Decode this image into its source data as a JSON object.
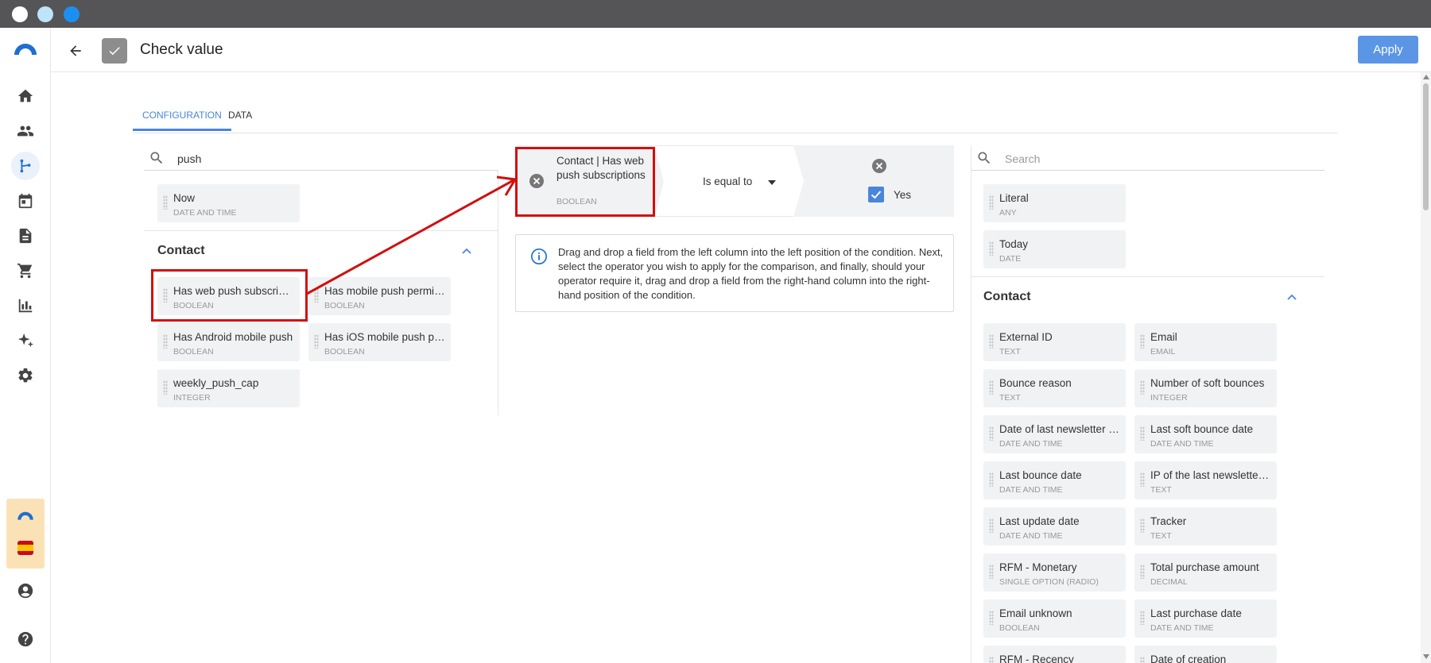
{
  "header": {
    "title": "Check value",
    "apply_label": "Apply"
  },
  "tabs": [
    {
      "label": "CONFIGURATION"
    },
    {
      "label": "DATA"
    }
  ],
  "left_panel": {
    "search_value": "push",
    "top_fields": [
      {
        "name": "Now",
        "type": "DATE AND TIME"
      }
    ],
    "section_title": "Contact",
    "contact_fields": [
      {
        "name": "Has web push subscriptions",
        "type": "BOOLEAN"
      },
      {
        "name": "Has mobile push permission",
        "type": "BOOLEAN"
      },
      {
        "name": "Has Android mobile push",
        "type": "BOOLEAN"
      },
      {
        "name": "Has iOS mobile push permission",
        "type": "BOOLEAN"
      },
      {
        "name": "weekly_push_cap",
        "type": "INTEGER"
      }
    ]
  },
  "condition": {
    "left_field_name": "Contact | Has web push subscriptions",
    "left_field_type": "BOOLEAN",
    "operator": "Is equal to",
    "right_value_label": "Yes",
    "right_checked": true
  },
  "info_text": "Drag and drop a field from the left column into the left position of the condition. Next, select the operator you wish to apply for the comparison, and finally, should your operator require it, drag and drop a field from the right-hand column into the right-hand position of the condition.",
  "right_panel": {
    "search_placeholder": "Search",
    "top_fields": [
      {
        "name": "Literal",
        "type": "ANY"
      },
      {
        "name": "Today",
        "type": "DATE"
      }
    ],
    "section_title": "Contact",
    "contact_fields": [
      {
        "name": "External ID",
        "type": "TEXT"
      },
      {
        "name": "Email",
        "type": "EMAIL"
      },
      {
        "name": "Bounce reason",
        "type": "TEXT"
      },
      {
        "name": "Number of soft bounces",
        "type": "INTEGER"
      },
      {
        "name": "Date of last newsletter opening",
        "type": "DATE AND TIME"
      },
      {
        "name": "Last soft bounce date",
        "type": "DATE AND TIME"
      },
      {
        "name": "Last bounce date",
        "type": "DATE AND TIME"
      },
      {
        "name": "IP of the last newsletter opening",
        "type": "TEXT"
      },
      {
        "name": "Last update date",
        "type": "DATE AND TIME"
      },
      {
        "name": "Tracker",
        "type": "TEXT"
      },
      {
        "name": "RFM - Monetary",
        "type": "SINGLE OPTION (RADIO)"
      },
      {
        "name": "Total purchase amount",
        "type": "DECIMAL"
      },
      {
        "name": "Email unknown",
        "type": "BOOLEAN"
      },
      {
        "name": "Last purchase date",
        "type": "DATE AND TIME"
      },
      {
        "name": "RFM - Recency",
        "type": ""
      },
      {
        "name": "Date of creation",
        "type": ""
      }
    ]
  },
  "colors": {
    "accent": "#4a86d8",
    "apply_button": "#5b95e6",
    "highlight": "#d20f0f",
    "card_bg": "#f1f2f4"
  }
}
